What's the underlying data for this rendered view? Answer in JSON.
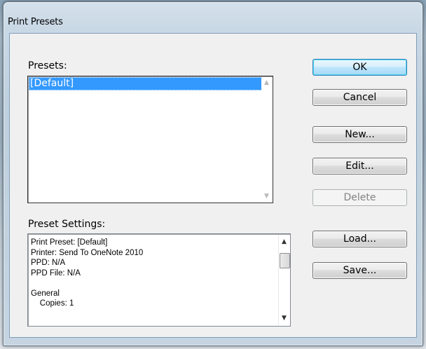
{
  "window": {
    "title": "Print Presets"
  },
  "presets": {
    "label": "Presets:",
    "items": [
      "[Default]"
    ],
    "selected_index": 0
  },
  "preset_settings": {
    "label": "Preset Settings:",
    "lines": [
      "Print Preset: [Default]",
      "Printer: Send To OneNote 2010",
      "PPD: N/A",
      "PPD File: N/A",
      "",
      "General",
      "    Copies: 1"
    ]
  },
  "buttons": {
    "ok": "OK",
    "cancel": "Cancel",
    "new": "New...",
    "edit": "Edit...",
    "delete": "Delete",
    "load": "Load...",
    "save": "Save..."
  },
  "colors": {
    "selection": "#3399ff",
    "default_button_border": "#3c7fb1",
    "disabled_text": "#838383"
  }
}
